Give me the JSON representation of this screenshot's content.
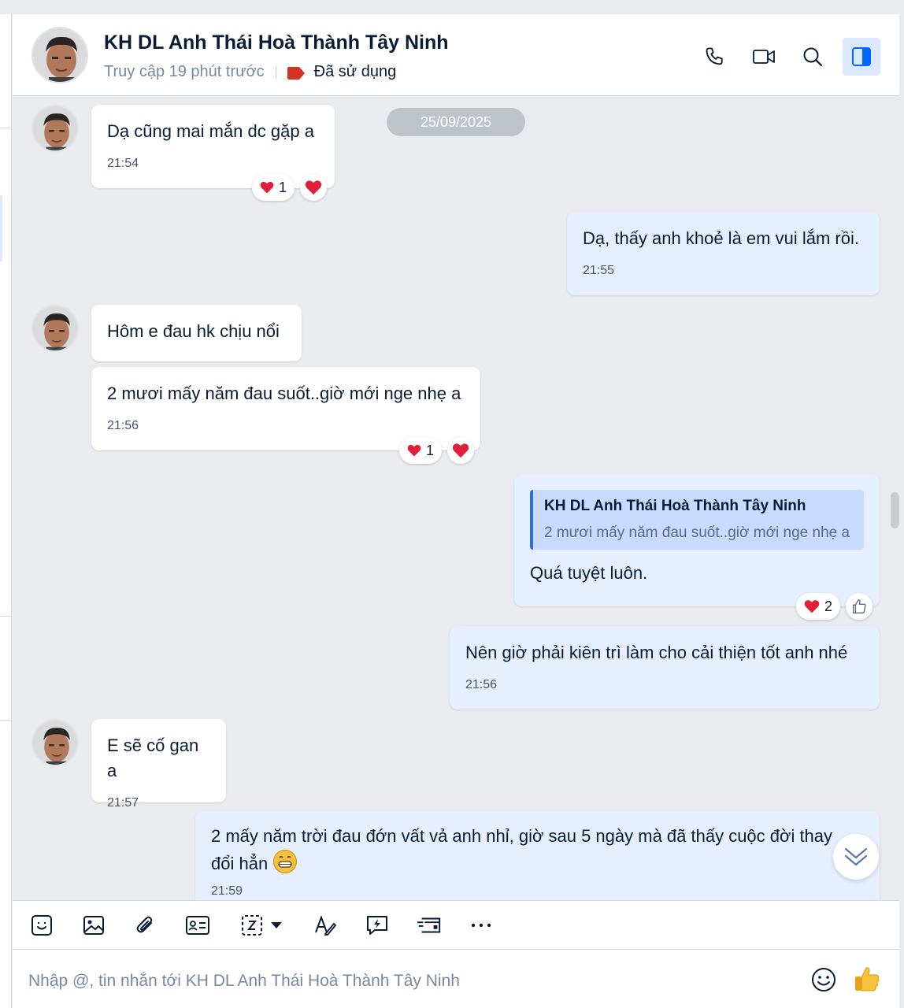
{
  "header": {
    "title": "KH DL Anh Thái Hoà Thành Tây Ninh",
    "status": "Truy cập 19 phút trước",
    "tag_label": "Đã sử dụng",
    "tag_color": "#d93025"
  },
  "date_divider": "25/09/2025",
  "messages": [
    {
      "direction": "in",
      "text": "Dạ cũng mai mắn dc gặp a",
      "time": "21:54",
      "reactions": [
        {
          "emoji": "heart",
          "count": "1"
        },
        {
          "emoji": "heart",
          "count": ""
        }
      ]
    },
    {
      "direction": "out",
      "text": "Dạ, thấy anh khoẻ là em vui lắm rồi.",
      "time": "21:55"
    },
    {
      "direction": "in",
      "text": "Hôm e đau hk chịu nổi",
      "time": ""
    },
    {
      "direction": "in",
      "text": "2 mươi mấy năm đau suốt..giờ mới nge nhẹ a",
      "time": "21:56",
      "reactions": [
        {
          "emoji": "heart",
          "count": "1"
        },
        {
          "emoji": "heart",
          "count": ""
        }
      ]
    },
    {
      "direction": "out",
      "quote": {
        "name": "KH DL Anh Thái Hoà Thành Tây Ninh",
        "text": "2 mươi mấy năm đau suốt..giờ mới nge nhẹ a"
      },
      "text": "Quá tuyệt luôn.",
      "time": "",
      "reactions": [
        {
          "emoji": "heart",
          "count": "2"
        },
        {
          "emoji": "thumbs-up",
          "count": ""
        }
      ]
    },
    {
      "direction": "out",
      "text": "Nên giờ phải kiên trì làm cho cải thiện tốt anh nhé",
      "time": "21:56"
    },
    {
      "direction": "in",
      "text": "E sẽ cố gan a",
      "time": "21:57"
    },
    {
      "direction": "out",
      "text": "2 mấy năm trời đau đớn vất vả anh nhỉ, giờ sau 5 ngày mà đã thấy cuộc đời thay",
      "text_line2": "đổi hẳn",
      "emoji": "grinning-face",
      "time": "21:59"
    }
  ],
  "toolbar": [
    "sticker-icon",
    "image-icon",
    "attachment-icon",
    "contact-card-icon",
    "screenshot-icon",
    "format-text-icon",
    "quick-message-icon",
    "card-icon",
    "more-icon"
  ],
  "composer": {
    "placeholder": "Nhập @, tin nhắn tới KH DL Anh Thái Hoà Thành Tây Ninh"
  },
  "colors": {
    "incoming_bubble": "#ffffff",
    "outgoing_bubble": "#e5efff",
    "quote_bar": "#2b6ee0",
    "heart": "#e0203a",
    "accent": "#0068ff"
  }
}
